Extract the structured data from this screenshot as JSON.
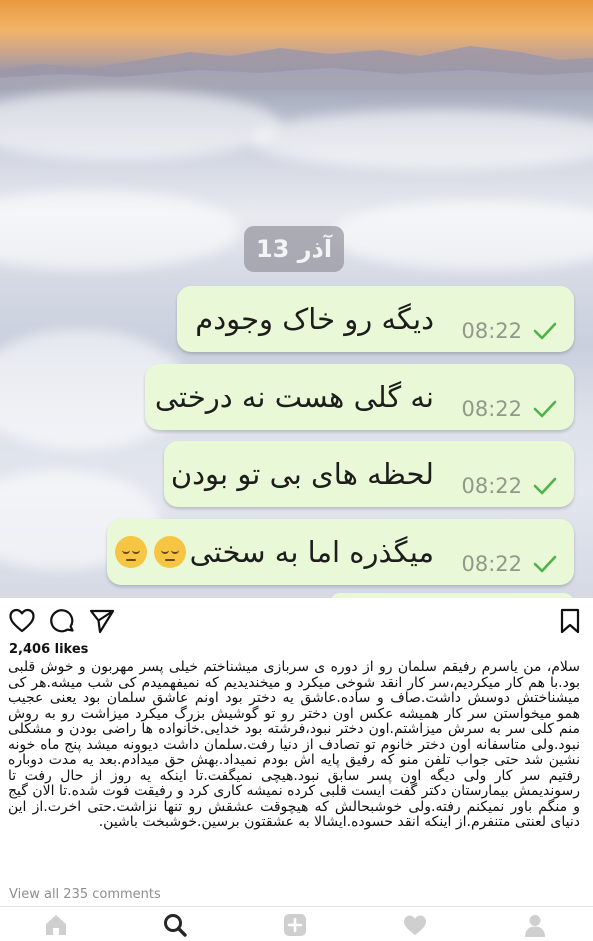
{
  "post": {
    "chat": {
      "date_chip": "13 آذر",
      "messages": [
        {
          "text": "دیگه رو خاک وجودم",
          "time": "08:22"
        },
        {
          "text": "نه گلی هست نه درختی",
          "time": "08:22"
        },
        {
          "text": "لحظه های بی تو بودن",
          "time": "08:22"
        },
        {
          "text": "میگذره اما به سختی",
          "time": "08:22",
          "emoji": "pensive-face-icon"
        }
      ]
    },
    "likes": "2,406 likes",
    "caption": "سلام، من یاسرم رفیقم سلمان رو از دوره ی سربازی میشناختم خیلی پسر مهربون و خوش قلبی بود.با هم کار میکردیم،سر کار انقد شوخی میکرد و میخندیدیم که نمیفهمیدم کی شب میشه.هر کی میشناختش دوسش داشت.صاف و ساده.عاشق یه دختر بود اونم عاشق سلمان بود یعنی عجیب همو میخواستن سر کار همیشه عکس اون دختر رو تو گوشیش بزرگ میکرد میزاشت رو به روش منم کلی سر به سرش میزاشتم.اون دختر نبود،فرشته بود خدایی.خانواده ها راضی بودن و مشکلی نبود.ولی متاسفانه اون دختر خانوم تو تصادف از دنیا رفت.سلمان داشت دیوونه میشد پنج ماه خونه نشین شد حتی جواب تلفن منو که رفیق پایه اش بودم نمیداد.بهش حق میدادم.بعد یه مدت دوباره رفتیم سر کار ولی دیگه اون پسر سابق نبود.هیچی نمیگفت.تا اینکه یه روز از حال رفت تا رسوندیمش بیمارستان دکتر گفت ایست قلبی کرده نمیشه کاری کرد و رفیقت فوت شده.تا الان گیج و منگم باور نمیکنم رفته.ولی خوشبحالش که هیچوقت عشقش رو تنها نزاشت.حتی اخرت.از این دنیای لعنتی متنفرم.از اینکه انقد حسوده.ایشالا به عشقتون برسین.خوشبخت باشین.",
    "view_comments": "View all 235 comments"
  },
  "icons": {
    "like": "heart-outline-icon",
    "comment": "comment-bubble-icon",
    "share": "paper-plane-icon",
    "save": "bookmark-icon",
    "nav": [
      "home-icon",
      "search-icon",
      "add-post-icon",
      "activity-heart-icon",
      "profile-icon"
    ]
  },
  "colors": {
    "bubble": "#e9f8d6",
    "check": "#4fb34a",
    "nav_inactive": "#cfcfcf",
    "nav_active": "#262626",
    "muted_text": "#8e8e8e"
  }
}
